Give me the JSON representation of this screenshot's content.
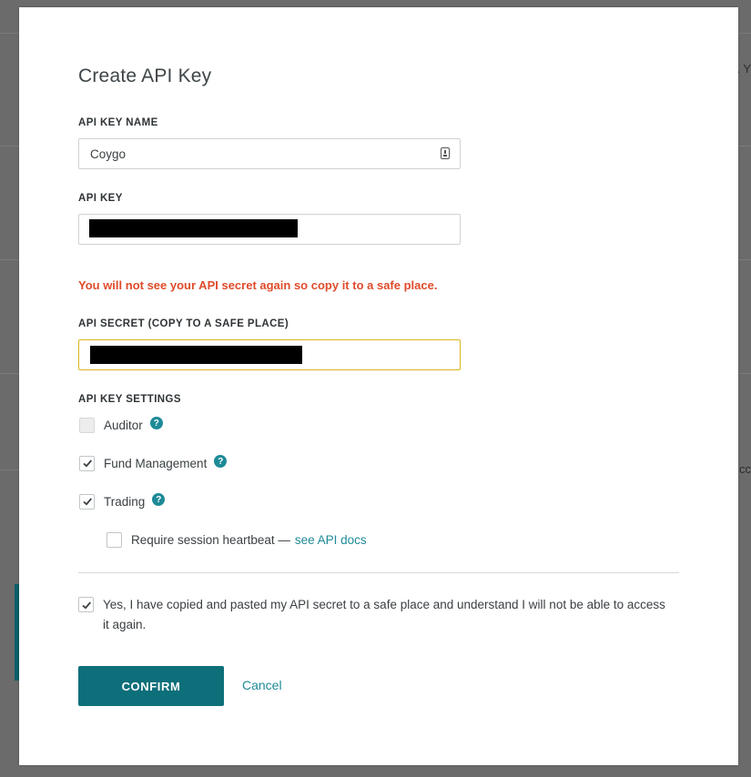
{
  "background": {
    "fragments": [
      ". Y",
      "cc"
    ],
    "accent_color": "#0b5f68"
  },
  "modal": {
    "title": "Create API Key",
    "api_key_name": {
      "label": "API KEY NAME",
      "value": "Coygo",
      "icon": "keychain-icon"
    },
    "api_key": {
      "label": "API KEY",
      "value_redacted": true
    },
    "warning": "You will not see your API secret again so copy it to a safe place.",
    "api_secret": {
      "label": "API SECRET (COPY TO A SAFE PLACE)",
      "value_redacted": true
    },
    "settings": {
      "label": "API KEY SETTINGS",
      "options": [
        {
          "label": "Auditor",
          "checked": false,
          "disabled": true,
          "help_icon": "?"
        },
        {
          "label": "Fund Management",
          "checked": true,
          "help_icon": "?"
        },
        {
          "label": "Trading",
          "checked": true,
          "help_icon": "?"
        }
      ],
      "heartbeat": {
        "label": "Require session heartbeat —",
        "link": "see API docs",
        "checked": false
      }
    },
    "consent": {
      "text": "Yes, I have copied and pasted my API secret to a safe place and understand I will not be able to access it again.",
      "checked": true
    },
    "confirm_label": "CONFIRM",
    "cancel_label": "Cancel"
  },
  "colors": {
    "primary": "#0d6f7a",
    "link": "#1e8a97",
    "warning": "#df4b2a",
    "focus_border": "#d7b61d"
  }
}
